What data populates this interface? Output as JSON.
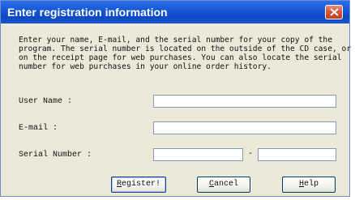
{
  "window": {
    "title": "Enter registration information"
  },
  "description": "Enter your name, E-mail, and the serial number for your copy of the\nprogram. The serial number is located on the outside of the CD case, or\non the receipt page for web purchases. You can also locate the serial\nnumber for web purchases in your online order history.",
  "form": {
    "user_name_label": "User Name :",
    "user_name_value": "",
    "email_label": "E-mail :",
    "email_value": "",
    "serial_label": "Serial Number :",
    "serial_part1_value": "",
    "serial_separator": "-",
    "serial_part2_value": ""
  },
  "buttons": {
    "register_mnemonic": "R",
    "register_rest": "egister!",
    "cancel_mnemonic": "C",
    "cancel_rest": "ancel",
    "help_mnemonic": "H",
    "help_rest": "elp"
  },
  "icons": {
    "close": "close-icon"
  },
  "colors": {
    "titlebar": "#0c49c4",
    "close_button": "#d4573a",
    "dialog_background": "#ece9d8",
    "field_border": "#7f9db9"
  }
}
